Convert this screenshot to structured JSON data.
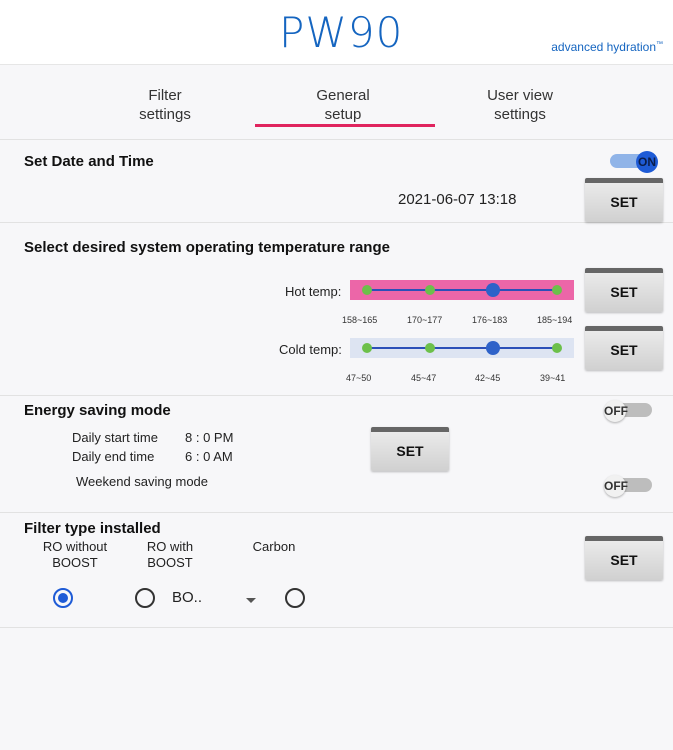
{
  "header": {
    "logo": "PW90",
    "tagline": "advanced hydration",
    "trademark": "™"
  },
  "tabs": [
    {
      "label": "Filter\nsettings"
    },
    {
      "label": "General\nsetup",
      "active": true
    },
    {
      "label": "User view\nsettings"
    }
  ],
  "date_time": {
    "title": "Set Date and Time",
    "toggle": "ON",
    "value": "2021-06-07 13:18",
    "set_label": "SET"
  },
  "temperature": {
    "title": "Select desired system operating temperature range",
    "hot": {
      "label": "Hot temp:",
      "ranges": [
        "158~165",
        "170~177",
        "176~183",
        "185~194"
      ],
      "selected_index": 2,
      "set_label": "SET"
    },
    "cold": {
      "label": "Cold temp:",
      "ranges": [
        "47~50",
        "45~47",
        "42~45",
        "39~41"
      ],
      "selected_index": 2,
      "set_label": "SET"
    }
  },
  "energy": {
    "title": "Energy saving mode",
    "toggle": "OFF",
    "start_label": "Daily start time",
    "start_value": "8 : 0  PM",
    "end_label": "Daily end time",
    "end_value": "6 : 0  AM",
    "set_label": "SET",
    "weekend_label": "Weekend saving mode",
    "weekend_toggle": "OFF"
  },
  "filter_type": {
    "title": "Filter type installed",
    "options": [
      "RO without\nBOOST",
      "RO with\nBOOST",
      "Carbon"
    ],
    "selected_index": 0,
    "boost_value": "BO..",
    "set_label": "SET"
  },
  "colors": {
    "brand": "#1565c0",
    "tab_active": "#e0245e",
    "hot_track": "#ec66a8",
    "cold_track": "#dde4f2",
    "dot": "#6cc04a",
    "dot_selected": "#2e62c9"
  }
}
